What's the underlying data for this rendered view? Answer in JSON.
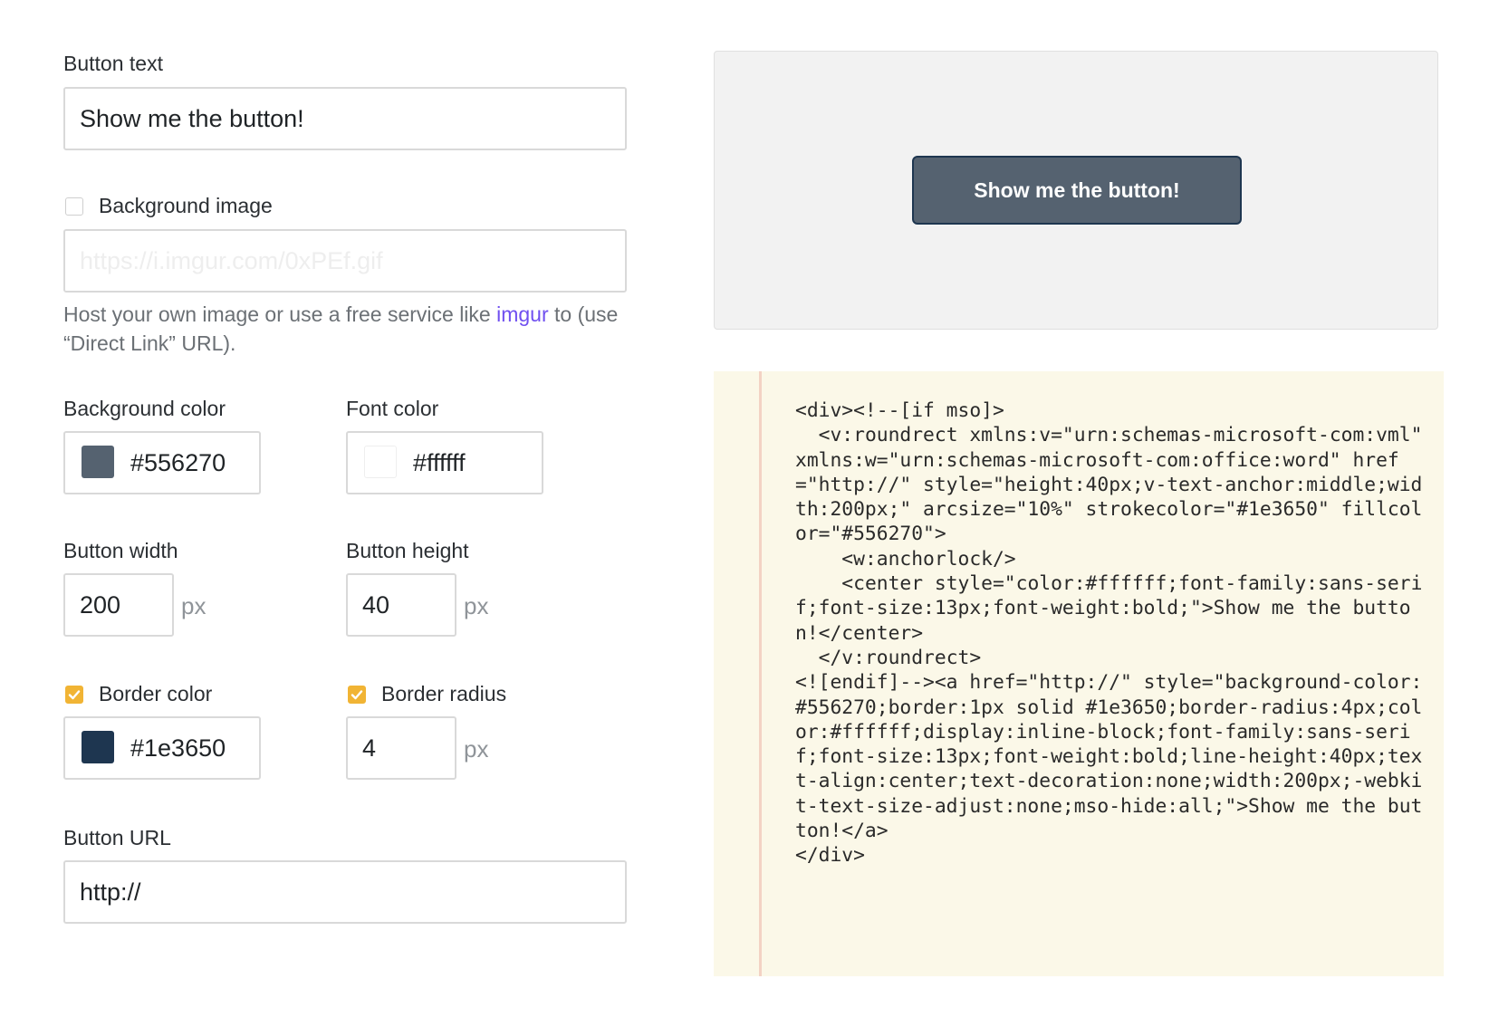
{
  "form": {
    "button_text": {
      "label": "Button text",
      "value": "Show me the button!"
    },
    "background_image": {
      "label": "Background image",
      "checked": false,
      "placeholder": "https://i.imgur.com/0xPEf.gif",
      "help_before": "Host your own image or use a free service like ",
      "help_link": "imgur",
      "help_after": " to (use “Direct Link” URL)."
    },
    "background_color": {
      "label": "Background color",
      "value": "#556270",
      "swatch": "#556270"
    },
    "font_color": {
      "label": "Font color",
      "value": "#ffffff",
      "swatch": "#ffffff"
    },
    "button_width": {
      "label": "Button width",
      "value": "200",
      "unit": "px"
    },
    "button_height": {
      "label": "Button height",
      "value": "40",
      "unit": "px"
    },
    "border_color": {
      "label": "Border color",
      "checked": true,
      "value": "#1e3650",
      "swatch": "#1e3650"
    },
    "border_radius": {
      "label": "Border radius",
      "checked": true,
      "value": "4",
      "unit": "px"
    },
    "button_url": {
      "label": "Button URL",
      "value": "http://"
    }
  },
  "preview": {
    "button_label": "Show me the button!"
  },
  "code": {
    "text": "<div><!--[if mso]>\n  <v:roundrect xmlns:v=\"urn:schemas-microsoft-com:vml\" xmlns:w=\"urn:schemas-microsoft-com:office:word\" href=\"http://\" style=\"height:40px;v-text-anchor:middle;width:200px;\" arcsize=\"10%\" strokecolor=\"#1e3650\" fillcolor=\"#556270\">\n    <w:anchorlock/>\n    <center style=\"color:#ffffff;font-family:sans-serif;font-size:13px;font-weight:bold;\">Show me the button!</center>\n  </v:roundrect>\n<![endif]--><a href=\"http://\" style=\"background-color:#556270;border:1px solid #1e3650;border-radius:4px;color:#ffffff;display:inline-block;font-family:sans-serif;font-size:13px;font-weight:bold;line-height:40px;text-align:center;text-decoration:none;width:200px;-webkit-text-size-adjust:none;mso-hide:all;\">Show me the button!</a>\n</div>"
  },
  "colors": {
    "accent_checkbox": "#f1b434",
    "link": "#6f4ff0",
    "code_background": "#fbf8e8"
  }
}
